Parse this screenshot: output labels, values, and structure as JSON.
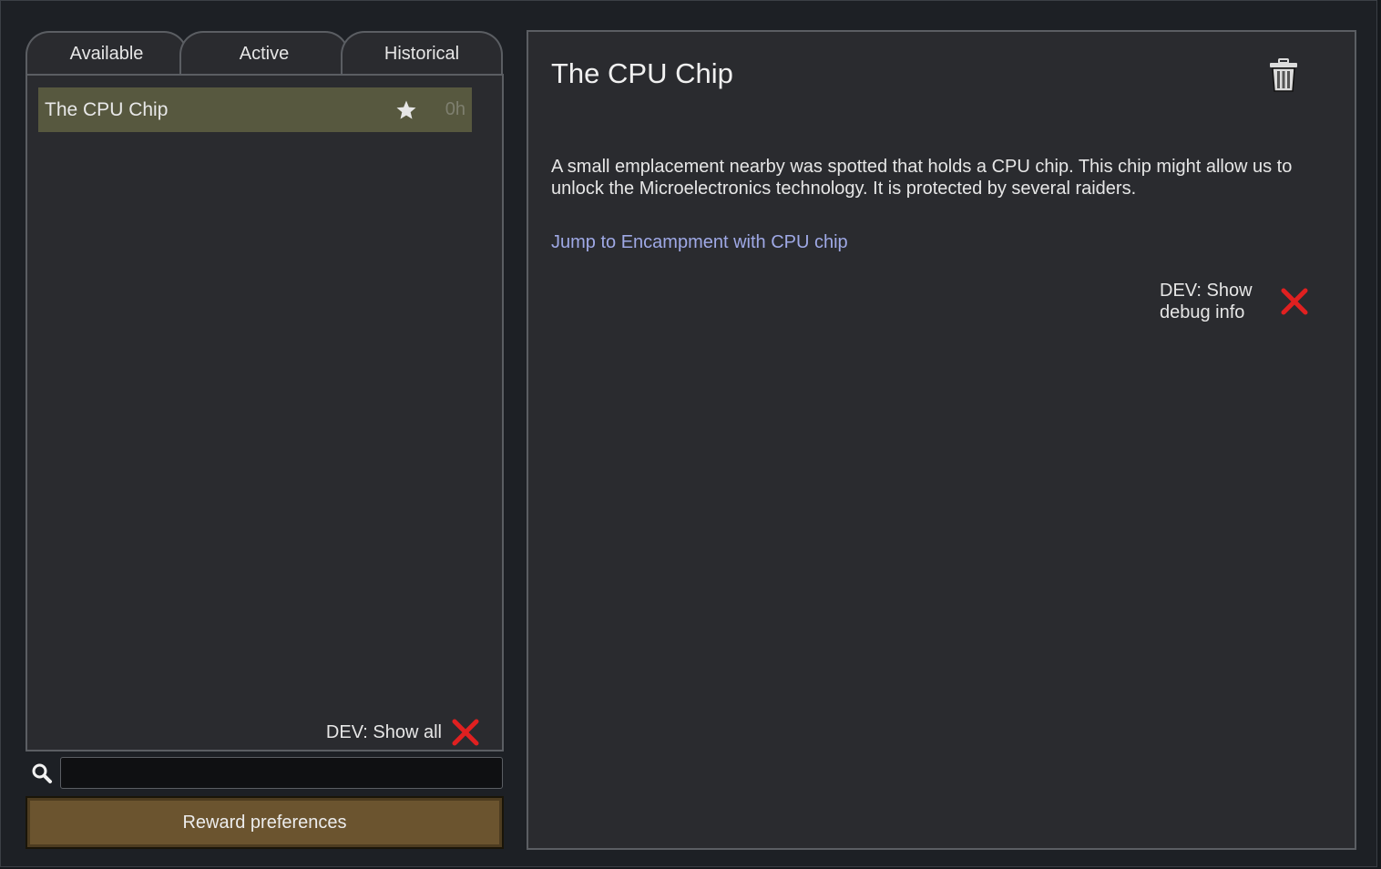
{
  "tabs": [
    {
      "label": "Available"
    },
    {
      "label": "Active"
    },
    {
      "label": "Historical"
    }
  ],
  "quest_list": {
    "items": [
      {
        "name": "The CPU Chip",
        "icon": "star-icon",
        "time": "0h"
      }
    ],
    "dev_toggle_label": "DEV: Show all",
    "dev_toggle_icon": "red-x-icon"
  },
  "search": {
    "icon": "search-icon",
    "value": "",
    "placeholder": ""
  },
  "reward_button": {
    "label": "Reward preferences"
  },
  "detail": {
    "title": "The CPU Chip",
    "delete_icon": "trash-icon",
    "description": "A small emplacement nearby was spotted that holds a CPU chip. This chip might allow us to unlock the Microelectronics technology. It is protected by several raiders.",
    "jump_link": "Jump to Encampment with CPU chip",
    "dev_debug_label": "DEV: Show debug info",
    "dev_debug_icon": "red-x-icon"
  },
  "colors": {
    "selected_row": "#57583f",
    "reward_button": "#6b542f",
    "link": "#9fa9e6",
    "toggle_off": "#e02020"
  }
}
